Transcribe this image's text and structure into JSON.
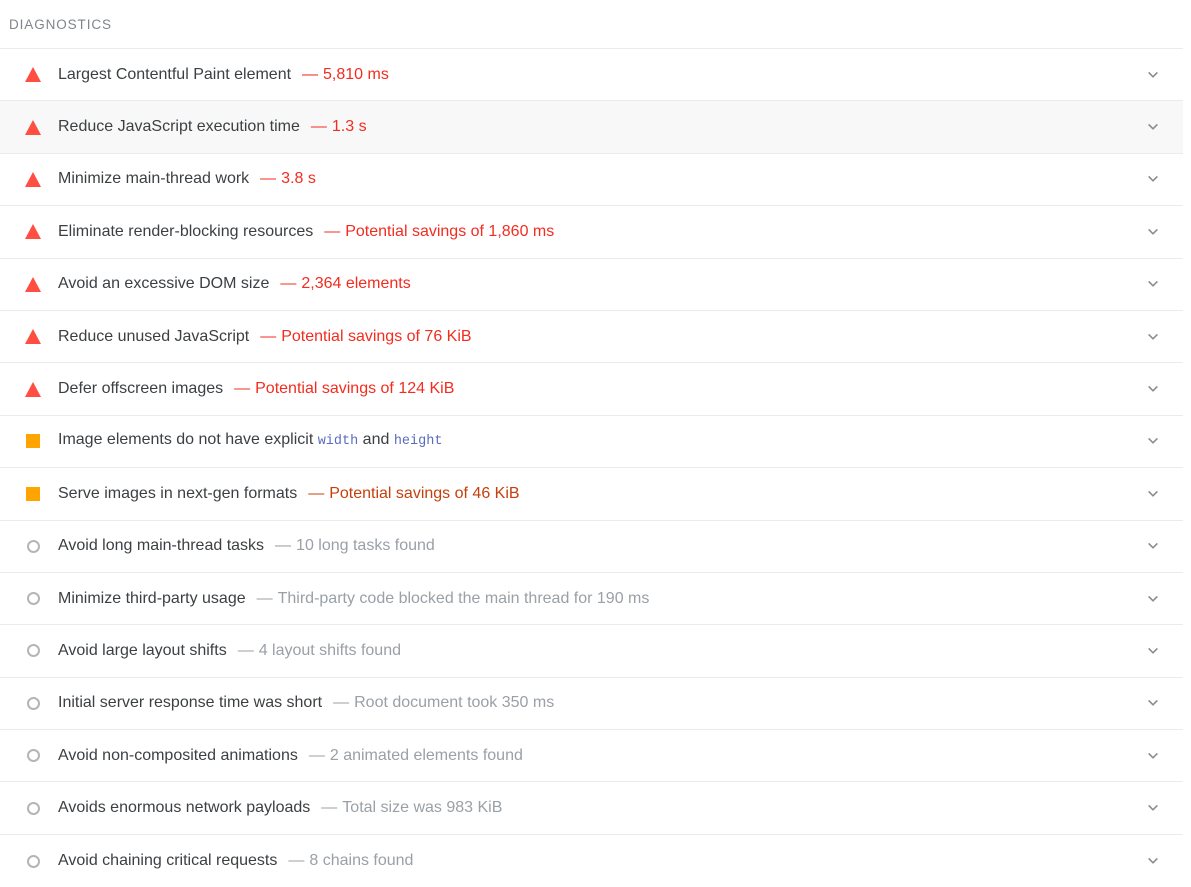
{
  "section": {
    "title": "DIAGNOSTICS"
  },
  "icons": {
    "fail": "fail-triangle-icon",
    "average": "average-square-icon",
    "pass": "pass-circle-icon",
    "expand": "chevron-down-icon"
  },
  "colors": {
    "fail": "#f32c20",
    "fail_icon": "#ff4e42",
    "average": "#c5400d",
    "average_icon": "#ffa400",
    "pass_text": "#9aa0a6",
    "pass_icon": "#b5b5b5",
    "title_text": "#3c4043",
    "header_text": "#80868b",
    "code_text": "#5a6bc0",
    "divider": "#ebebeb",
    "row_highlight": "#f8f8f8"
  },
  "audits": [
    {
      "title": "Largest Contentful Paint element",
      "title_parts": [
        {
          "text": "Largest Contentful Paint element",
          "code": false
        }
      ],
      "dash": "—",
      "value": "5,810 ms",
      "severity": "fail",
      "highlighted": false
    },
    {
      "title": "Reduce JavaScript execution time",
      "title_parts": [
        {
          "text": "Reduce JavaScript execution time",
          "code": false
        }
      ],
      "dash": "—",
      "value": "1.3 s",
      "severity": "fail",
      "highlighted": true
    },
    {
      "title": "Minimize main-thread work",
      "title_parts": [
        {
          "text": "Minimize main-thread work",
          "code": false
        }
      ],
      "dash": "—",
      "value": "3.8 s",
      "severity": "fail",
      "highlighted": false
    },
    {
      "title": "Eliminate render-blocking resources",
      "title_parts": [
        {
          "text": "Eliminate render-blocking resources",
          "code": false
        }
      ],
      "dash": "—",
      "value": "Potential savings of 1,860 ms",
      "severity": "fail",
      "highlighted": false
    },
    {
      "title": "Avoid an excessive DOM size",
      "title_parts": [
        {
          "text": "Avoid an excessive DOM size",
          "code": false
        }
      ],
      "dash": "—",
      "value": "2,364 elements",
      "severity": "fail",
      "highlighted": false
    },
    {
      "title": "Reduce unused JavaScript",
      "title_parts": [
        {
          "text": "Reduce unused JavaScript",
          "code": false
        }
      ],
      "dash": "—",
      "value": "Potential savings of 76 KiB",
      "severity": "fail",
      "highlighted": false
    },
    {
      "title": "Defer offscreen images",
      "title_parts": [
        {
          "text": "Defer offscreen images",
          "code": false
        }
      ],
      "dash": "—",
      "value": "Potential savings of 124 KiB",
      "severity": "fail",
      "highlighted": false
    },
    {
      "title": "Image elements do not have explicit width and height",
      "title_parts": [
        {
          "text": "Image elements do not have explicit ",
          "code": false
        },
        {
          "text": "width",
          "code": true
        },
        {
          "text": " and ",
          "code": false
        },
        {
          "text": "height",
          "code": true
        }
      ],
      "dash": "",
      "value": "",
      "severity": "average",
      "highlighted": false
    },
    {
      "title": "Serve images in next-gen formats",
      "title_parts": [
        {
          "text": "Serve images in next-gen formats",
          "code": false
        }
      ],
      "dash": "—",
      "value": "Potential savings of 46 KiB",
      "severity": "average",
      "highlighted": false
    },
    {
      "title": "Avoid long main-thread tasks",
      "title_parts": [
        {
          "text": "Avoid long main-thread tasks",
          "code": false
        }
      ],
      "dash": "—",
      "value": "10 long tasks found",
      "severity": "pass",
      "highlighted": false
    },
    {
      "title": "Minimize third-party usage",
      "title_parts": [
        {
          "text": "Minimize third-party usage",
          "code": false
        }
      ],
      "dash": "—",
      "value": "Third-party code blocked the main thread for 190 ms",
      "severity": "pass",
      "highlighted": false
    },
    {
      "title": "Avoid large layout shifts",
      "title_parts": [
        {
          "text": "Avoid large layout shifts",
          "code": false
        }
      ],
      "dash": "—",
      "value": "4 layout shifts found",
      "severity": "pass",
      "highlighted": false
    },
    {
      "title": "Initial server response time was short",
      "title_parts": [
        {
          "text": "Initial server response time was short",
          "code": false
        }
      ],
      "dash": "—",
      "value": "Root document took 350 ms",
      "severity": "pass",
      "highlighted": false
    },
    {
      "title": "Avoid non-composited animations",
      "title_parts": [
        {
          "text": "Avoid non-composited animations",
          "code": false
        }
      ],
      "dash": "—",
      "value": "2 animated elements found",
      "severity": "pass",
      "highlighted": false
    },
    {
      "title": "Avoids enormous network payloads",
      "title_parts": [
        {
          "text": "Avoids enormous network payloads",
          "code": false
        }
      ],
      "dash": "—",
      "value": "Total size was 983 KiB",
      "severity": "pass",
      "highlighted": false
    },
    {
      "title": "Avoid chaining critical requests",
      "title_parts": [
        {
          "text": "Avoid chaining critical requests",
          "code": false
        }
      ],
      "dash": "—",
      "value": "8 chains found",
      "severity": "pass",
      "highlighted": false
    }
  ]
}
